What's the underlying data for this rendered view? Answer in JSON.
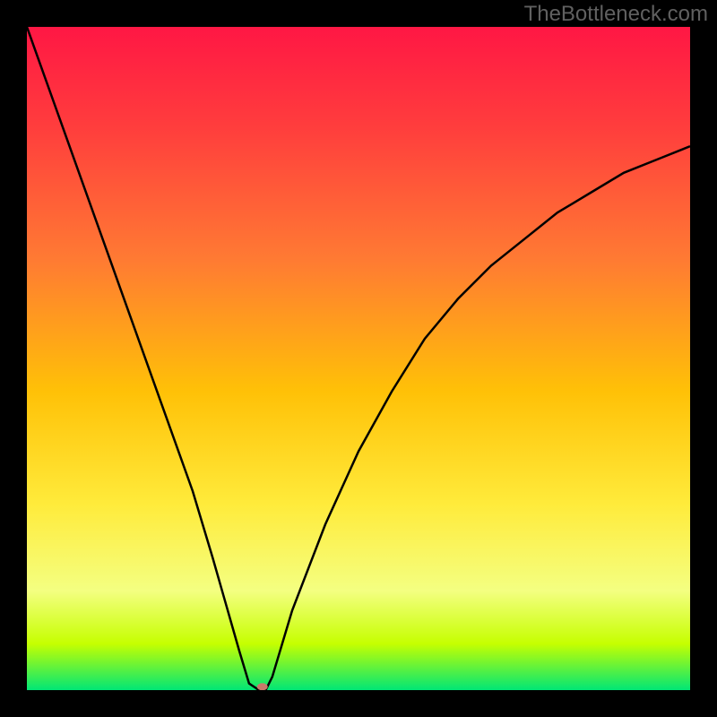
{
  "watermark": "TheBottleneck.com",
  "chart_data": {
    "type": "line",
    "title": "",
    "xlabel": "",
    "ylabel": "",
    "xlim": [
      0,
      100
    ],
    "ylim": [
      0,
      100
    ],
    "background_gradient": {
      "type": "vertical",
      "stops": [
        {
          "offset": 0,
          "color": "#ff1744"
        },
        {
          "offset": 0.15,
          "color": "#ff3d3d"
        },
        {
          "offset": 0.35,
          "color": "#ff7a33"
        },
        {
          "offset": 0.55,
          "color": "#ffc107"
        },
        {
          "offset": 0.72,
          "color": "#ffeb3b"
        },
        {
          "offset": 0.85,
          "color": "#f4ff81"
        },
        {
          "offset": 0.93,
          "color": "#c6ff00"
        },
        {
          "offset": 1.0,
          "color": "#00e676"
        }
      ]
    },
    "series": [
      {
        "name": "bottleneck-curve",
        "color": "#000000",
        "x": [
          0,
          5,
          10,
          15,
          20,
          25,
          28,
          30,
          32,
          33.5,
          35,
          36,
          37,
          40,
          45,
          50,
          55,
          60,
          65,
          70,
          75,
          80,
          85,
          90,
          95,
          100
        ],
        "values": [
          100,
          86,
          72,
          58,
          44,
          30,
          20,
          13,
          6,
          1,
          0,
          0,
          2,
          12,
          25,
          36,
          45,
          53,
          59,
          64,
          68,
          72,
          75,
          78,
          80,
          82
        ]
      }
    ],
    "marker": {
      "name": "minimum-point",
      "x": 35.5,
      "y": 0.5,
      "color": "#c97a6a",
      "rx": 6,
      "ry": 4
    }
  }
}
